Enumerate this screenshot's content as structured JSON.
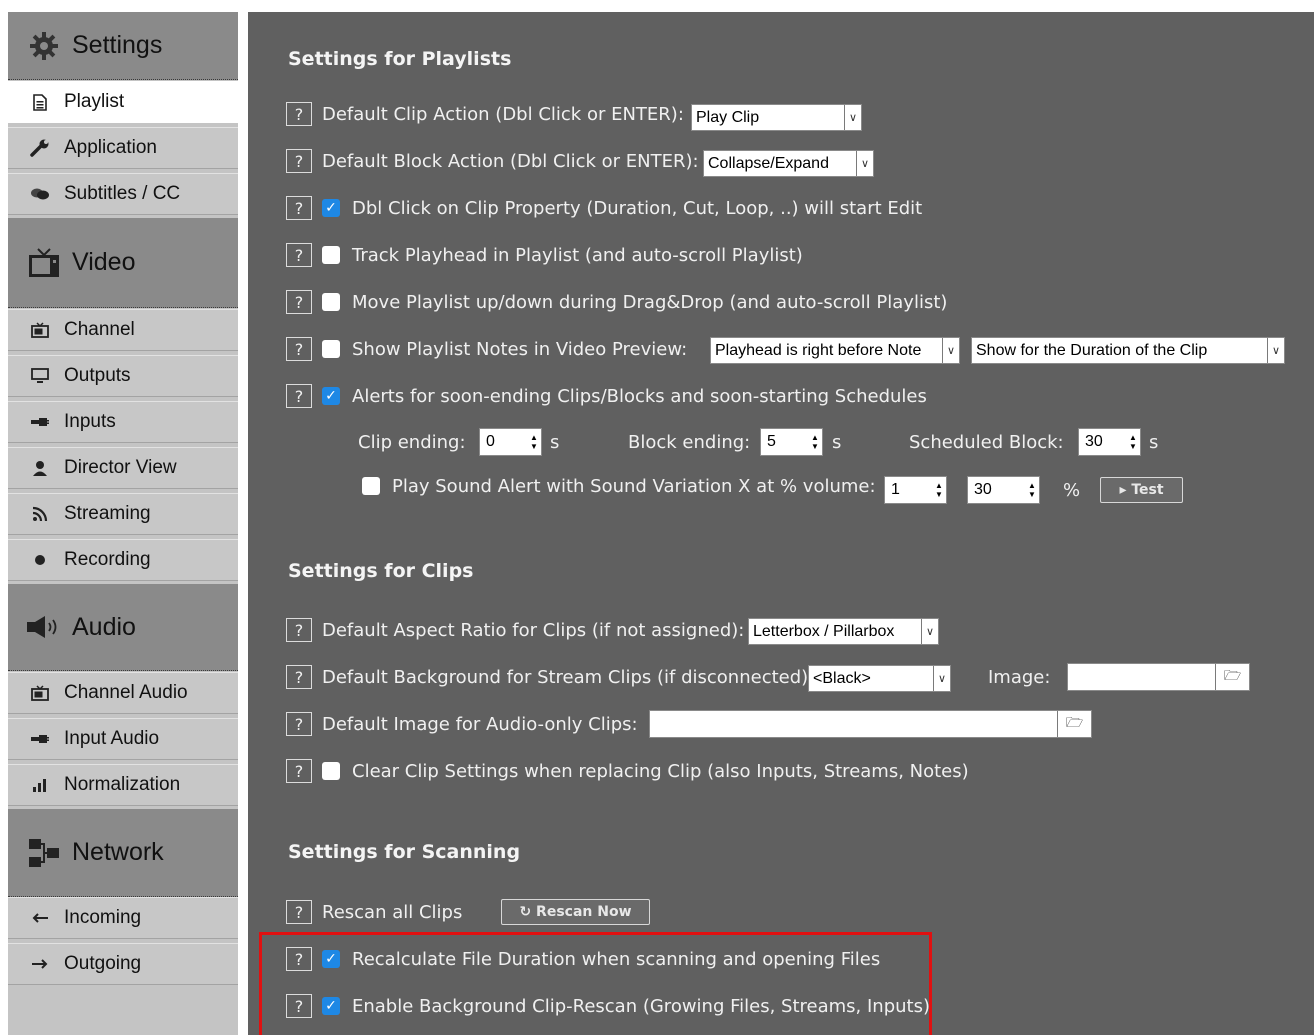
{
  "sidebar": {
    "groups": [
      {
        "title": "Settings",
        "icon": "gear-icon",
        "items": [
          {
            "label": "Playlist",
            "icon": "playlist-doc-icon",
            "active": true
          },
          {
            "label": "Application",
            "icon": "wrench-icon"
          },
          {
            "label": "Subtitles / CC",
            "icon": "speech-bubbles-icon"
          }
        ]
      },
      {
        "title": "Video",
        "icon": "tv-icon",
        "items": [
          {
            "label": "Channel",
            "icon": "tv-small-icon"
          },
          {
            "label": "Outputs",
            "icon": "monitor-icon"
          },
          {
            "label": "Inputs",
            "icon": "input-plug-icon"
          },
          {
            "label": "Director View",
            "icon": "person-icon"
          },
          {
            "label": "Streaming",
            "icon": "rss-icon"
          },
          {
            "label": "Recording",
            "icon": "record-dot-icon"
          }
        ]
      },
      {
        "title": "Audio",
        "icon": "speaker-icon",
        "items": [
          {
            "label": "Channel Audio",
            "icon": "tv-small-icon"
          },
          {
            "label": "Input Audio",
            "icon": "input-plug-icon"
          },
          {
            "label": "Normalization",
            "icon": "bars-icon"
          }
        ]
      },
      {
        "title": "Network",
        "icon": "network-icon",
        "items": [
          {
            "label": "Incoming",
            "icon": "arrow-left-icon"
          },
          {
            "label": "Outgoing",
            "icon": "arrow-right-icon"
          }
        ]
      }
    ]
  },
  "playlists": {
    "title": "Settings for Playlists",
    "help": "?",
    "clip_action": {
      "label": "Default Clip Action (Dbl Click or ENTER):",
      "value": "Play Clip"
    },
    "block_action": {
      "label": "Default Block Action (Dbl Click or ENTER):",
      "value": "Collapse/Expand"
    },
    "dbl_click_edit": {
      "label": "Dbl Click on Clip Property (Duration, Cut, Loop, ..) will start Edit",
      "checked": true
    },
    "track_playhead": {
      "label": "Track Playhead in Playlist (and auto-scroll Playlist)",
      "checked": false
    },
    "move_playlist": {
      "label": "Move Playlist up/down during Drag&Drop (and auto-scroll Playlist)",
      "checked": false
    },
    "show_notes": {
      "label": "Show Playlist Notes in Video Preview:",
      "checked": false,
      "when": "Playhead is right before Note",
      "duration": "Show for the Duration of the Clip"
    },
    "alerts": {
      "label": "Alerts for soon-ending Clips/Blocks and soon-starting Schedules",
      "checked": true
    },
    "clip_ending": {
      "label": "Clip ending:",
      "value": "0",
      "unit": "s"
    },
    "block_ending": {
      "label": "Block ending:",
      "value": "5",
      "unit": "s"
    },
    "scheduled_block": {
      "label": "Scheduled Block:",
      "value": "30",
      "unit": "s"
    },
    "sound_alert": {
      "label": "Play Sound Alert with Sound Variation X at % volume:",
      "checked": false,
      "variation": "1",
      "volume": "30",
      "unit": "%",
      "test_label": "▸ Test"
    }
  },
  "clips": {
    "title": "Settings for Clips",
    "aspect_ratio": {
      "label": "Default Aspect Ratio for Clips (if not assigned):",
      "value": "Letterbox / Pillarbox"
    },
    "background": {
      "label": "Default Background for Stream Clips (if disconnected):",
      "value": "<Black>",
      "image_label": "Image:"
    },
    "audio_image": {
      "label": "Default Image for Audio-only Clips:"
    },
    "clear_settings": {
      "label": "Clear Clip Settings when replacing Clip (also Inputs, Streams, Notes)",
      "checked": false
    }
  },
  "scanning": {
    "title": "Settings for Scanning",
    "rescan": {
      "label": "Rescan all Clips",
      "button": "↻ Rescan Now"
    },
    "recalc_duration": {
      "label": "Recalculate File Duration when scanning and opening Files",
      "checked": true
    },
    "background_rescan": {
      "label": "Enable Background Clip-Rescan (Growing Files, Streams, Inputs)",
      "checked": true
    }
  },
  "colors": {
    "main_bg": "#606060",
    "sidebar_bg": "#c4c4c4",
    "checkbox_on": "#1e88e5",
    "highlight": "#e01010"
  }
}
